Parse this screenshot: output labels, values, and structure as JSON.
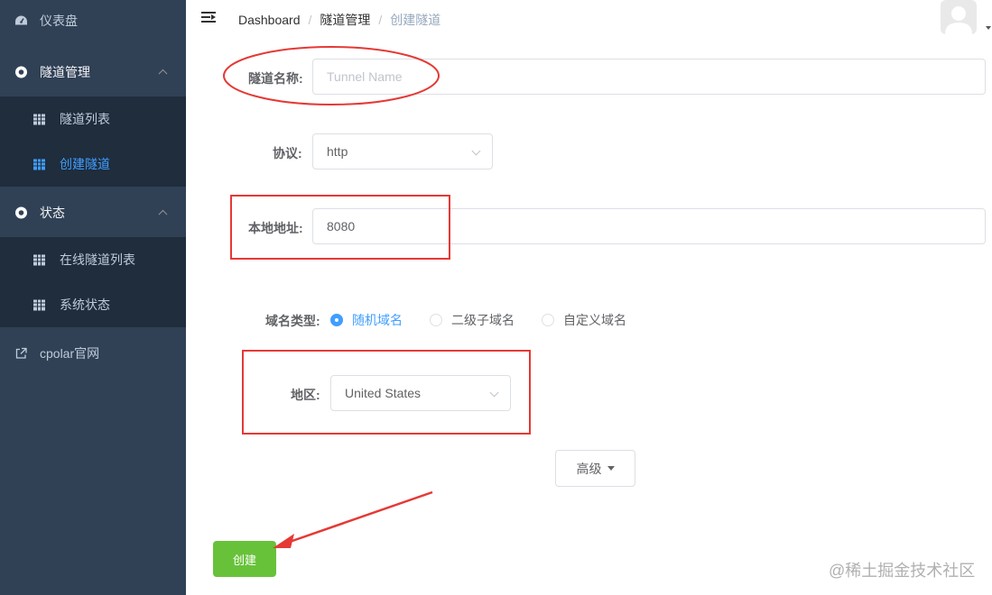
{
  "sidebar": {
    "dashboard": "仪表盘",
    "tunnel_mgmt": "隧道管理",
    "tunnel_list": "隧道列表",
    "create_tunnel": "创建隧道",
    "status": "状态",
    "online_tunnels": "在线隧道列表",
    "system_status": "系统状态",
    "cpolar_site": "cpolar官网"
  },
  "breadcrumb": {
    "home": "Dashboard",
    "sep": "/",
    "section": "隧道管理",
    "current": "创建隧道"
  },
  "form": {
    "name_label": "隧道名称:",
    "name_placeholder": "Tunnel Name",
    "protocol_label": "协议:",
    "protocol_value": "http",
    "local_label": "本地地址:",
    "local_value": "8080",
    "domain_type_label": "域名类型:",
    "domain_types": [
      "随机域名",
      "二级子域名",
      "自定义域名"
    ],
    "domain_type_selected": "随机域名",
    "region_label": "地区:",
    "region_value": "United States",
    "advanced_button": "高级",
    "create_button": "创建"
  },
  "watermark": "@稀土掘金技术社区",
  "colors": {
    "sidebar_bg": "#304156",
    "submenu_bg": "#1f2d3d",
    "active": "#409eff",
    "create_btn": "#67c23a",
    "annotation": "#e53935"
  }
}
